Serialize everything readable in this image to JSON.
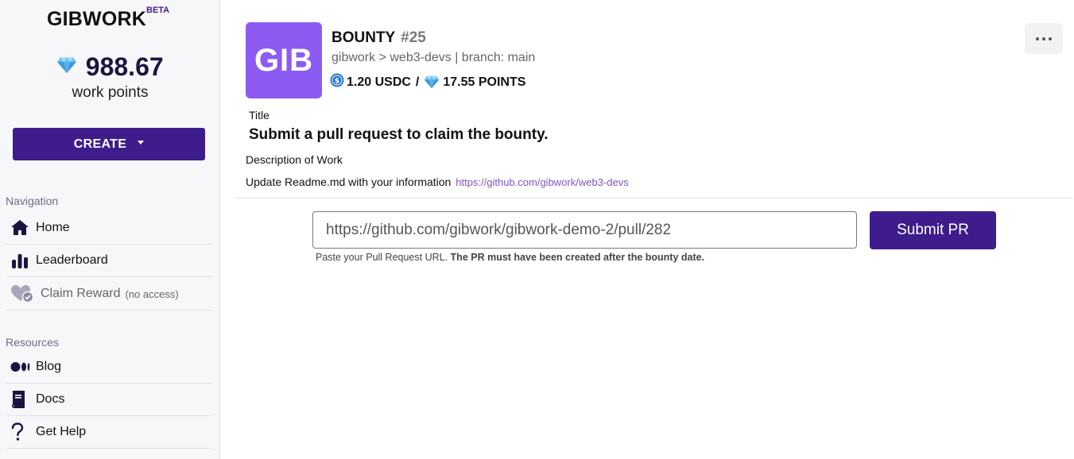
{
  "sidebar": {
    "brand": "GIBWORK",
    "beta": "BETA",
    "points_value": "988.67",
    "points_label": "work points",
    "create_label": "CREATE",
    "navigation_title": "Navigation",
    "nav_items": [
      {
        "label": "Home",
        "icon": "home-icon"
      },
      {
        "label": "Leaderboard",
        "icon": "bar-chart-icon"
      },
      {
        "label": "Claim Reward",
        "sub": "(no access)",
        "icon": "heart-check-icon"
      }
    ],
    "resources_title": "Resources",
    "resource_items": [
      {
        "label": "Blog",
        "icon": "medium-icon"
      },
      {
        "label": "Docs",
        "icon": "book-icon"
      },
      {
        "label": "Get Help",
        "icon": "question-icon"
      }
    ]
  },
  "bounty": {
    "logo_text": "GIB",
    "title": "BOUNTY",
    "number": "#25",
    "repo_line": "gibwork > web3-devs | branch: main",
    "usdc_amount": "1.20 USDC",
    "separator": "/",
    "points_amount": "17.55 POINTS",
    "title_label": "Title",
    "title_text": "Submit a pull request to claim the bounty.",
    "description_label": "Description of Work",
    "description_text": "Update Readme.md with your information",
    "description_link": "https://github.com/gibwork/web3-devs"
  },
  "submission": {
    "input_value": "https://github.com/gibwork/gibwork-demo-2/pull/282",
    "submit_label": "Submit PR",
    "hint_plain": "Paste your Pull Request URL.",
    "hint_bold": "The PR must have been created after the bounty date."
  },
  "colors": {
    "accent": "#3f1c8c",
    "logo_bg": "#8c5cf2",
    "link": "#7b57c9"
  }
}
